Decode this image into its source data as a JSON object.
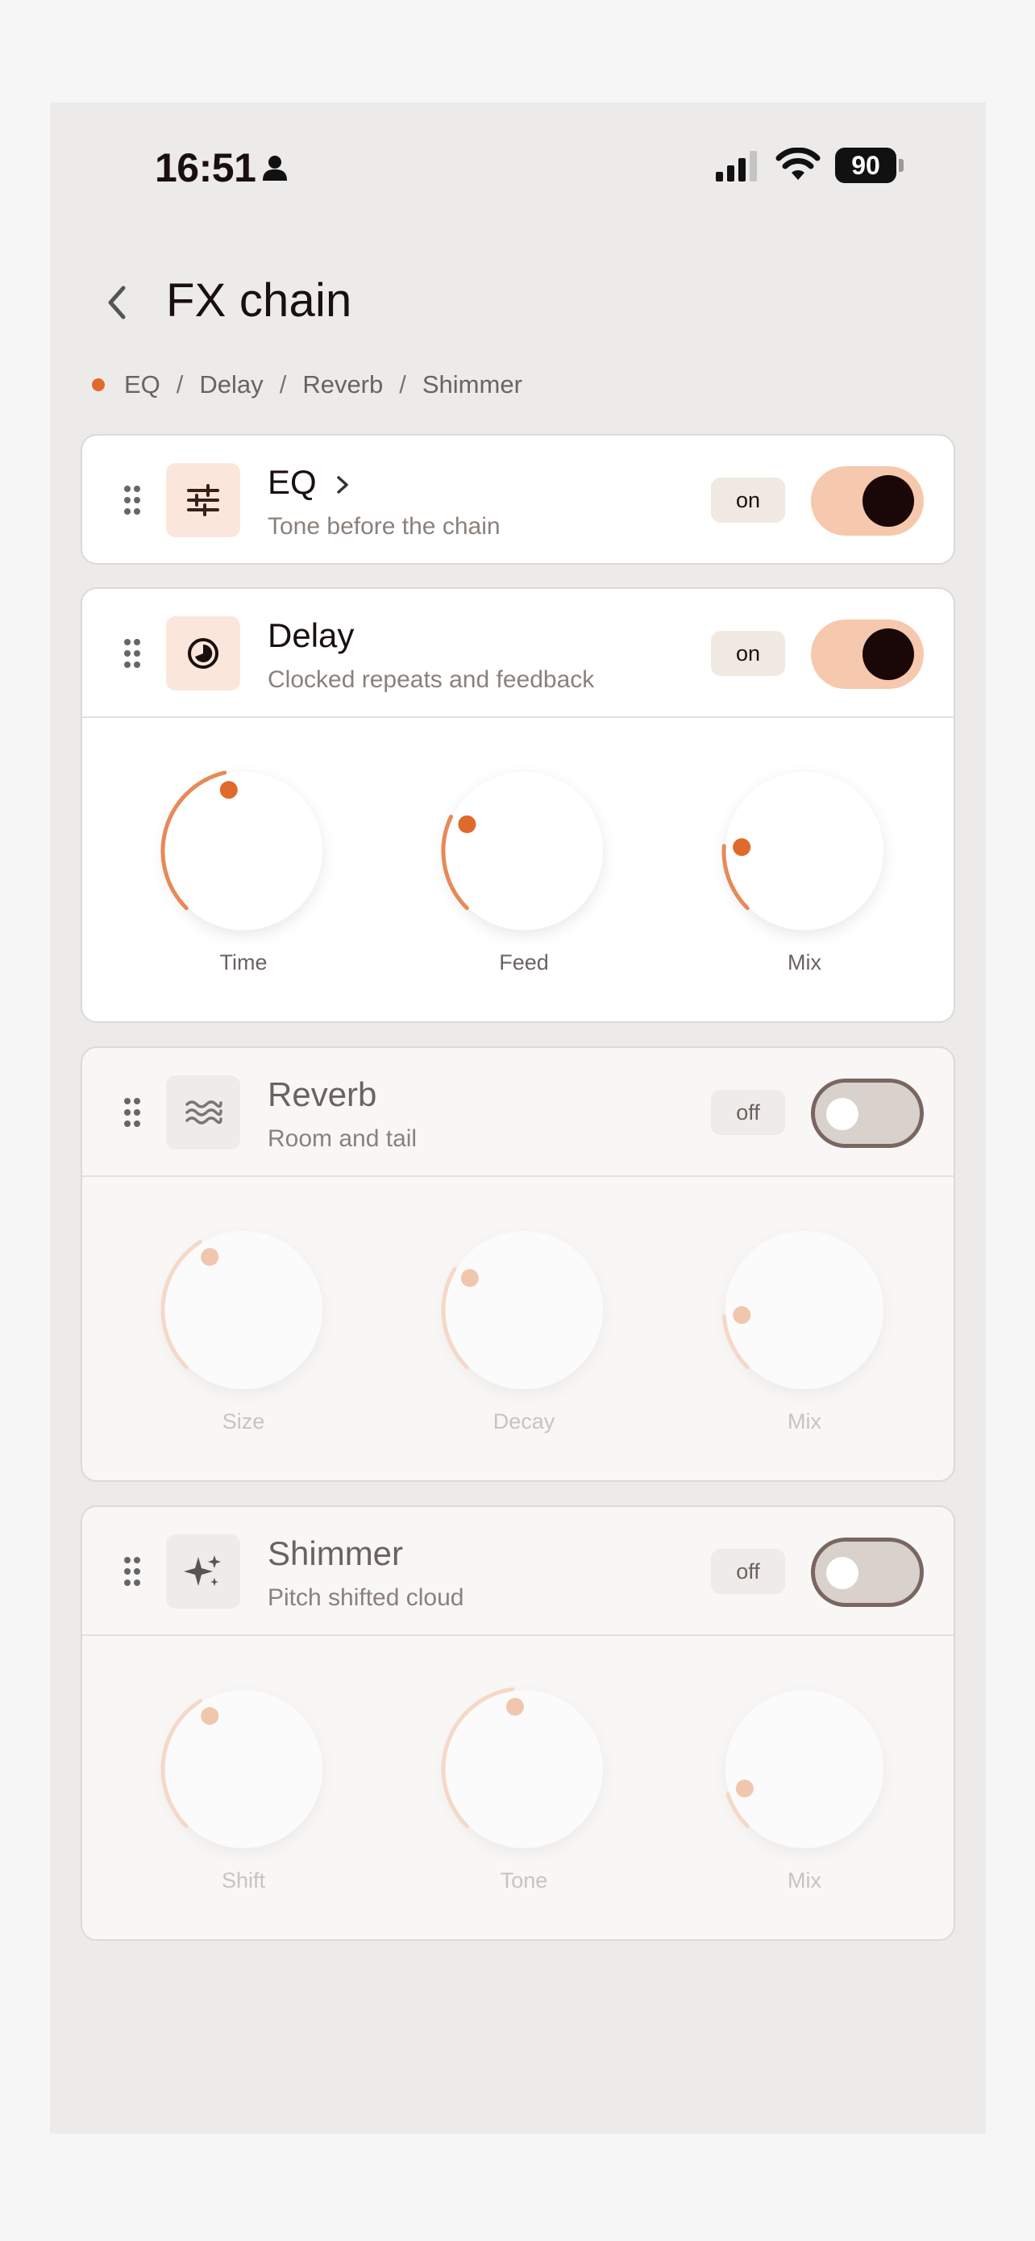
{
  "status_bar": {
    "time": "16:51",
    "battery": "90"
  },
  "header": {
    "title": "FX chain",
    "breadcrumb": [
      "EQ",
      "Delay",
      "Reverb",
      "Shimmer"
    ],
    "separator": "/"
  },
  "colors": {
    "accent": "#e0692c",
    "toggle_on": "#f6c8ad",
    "toggle_off": "#d9d1cc"
  },
  "effects": [
    {
      "name": "EQ",
      "description": "Tone before the chain",
      "state": "on",
      "icon": "sliders-icon",
      "has_chevron": true,
      "expanded": false,
      "knobs": []
    },
    {
      "name": "Delay",
      "description": "Clocked repeats and feedback",
      "state": "on",
      "icon": "clock-icon",
      "expanded": true,
      "knobs": [
        {
          "label": "Time",
          "level": 0.45
        },
        {
          "label": "Feed",
          "level": 0.26
        },
        {
          "label": "Mix",
          "level": 0.18
        }
      ]
    },
    {
      "name": "Reverb",
      "description": "Room and tail",
      "state": "off",
      "icon": "waves-icon",
      "expanded": true,
      "knobs": [
        {
          "label": "Size",
          "level": 0.38
        },
        {
          "label": "Decay",
          "level": 0.28
        },
        {
          "label": "Mix",
          "level": 0.15
        }
      ]
    },
    {
      "name": "Shimmer",
      "description": "Pitch shifted cloud",
      "state": "off",
      "icon": "sparkle-icon",
      "expanded": true,
      "knobs": [
        {
          "label": "Shift",
          "level": 0.38
        },
        {
          "label": "Tone",
          "level": 0.47
        },
        {
          "label": "Mix",
          "level": 0.1
        }
      ]
    }
  ]
}
